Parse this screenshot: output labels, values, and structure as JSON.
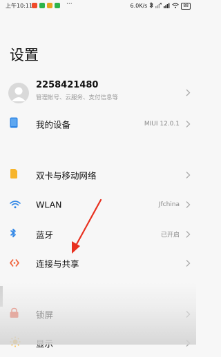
{
  "status": {
    "time": "上午10:11",
    "speed": "6.0K/s",
    "battery": "88"
  },
  "page": {
    "title": "设置"
  },
  "account": {
    "name": "2258421480",
    "subtitle": "管理帐号、云服务、支付信息等"
  },
  "my_device": {
    "label": "我的设备",
    "value": "MIUI 12.0.1"
  },
  "settings": [
    {
      "label": "双卡与移动网络",
      "value": ""
    },
    {
      "label": "WLAN",
      "value": "Jfchina"
    },
    {
      "label": "蓝牙",
      "value": "已开启"
    },
    {
      "label": "连接与共享",
      "value": ""
    }
  ],
  "settings2": [
    {
      "label": "锁屏",
      "value": ""
    },
    {
      "label": "显示",
      "value": ""
    }
  ],
  "colors": {
    "accent_blue": "#2f86e6",
    "sim_yellow": "#f7b52c",
    "share_orange": "#f0623a",
    "lock_red": "#e9573f",
    "display_yellow": "#f7b52c",
    "annotation_red": "#e8301f"
  },
  "icons": {
    "account": "user-avatar",
    "my_device": "tablet-icon",
    "dual_sim": "sim-card-icon",
    "wlan": "wifi-icon",
    "bluetooth": "bluetooth-icon",
    "connection": "share-icon",
    "lock_screen": "lock-icon",
    "display": "sun-icon"
  }
}
